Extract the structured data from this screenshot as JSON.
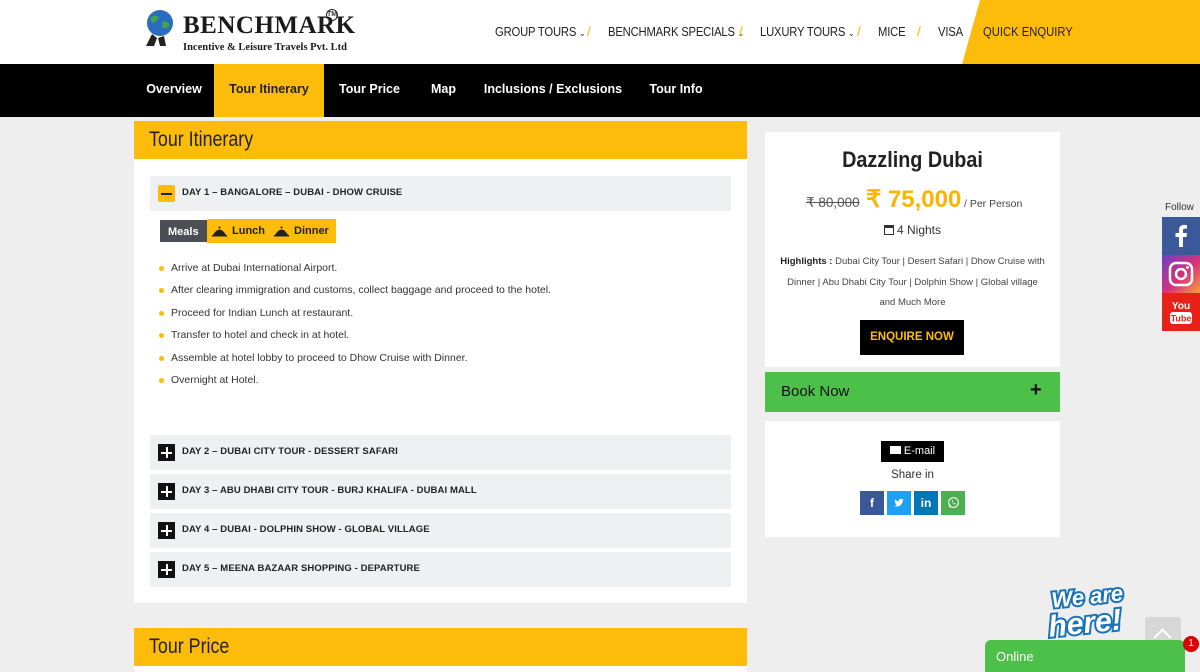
{
  "brand": {
    "name": "BENCHMARK",
    "trademark": "TM",
    "subtitle": "Incentive & Leisure Travels Pvt. Ltd"
  },
  "nav": {
    "items": [
      {
        "label": "GROUP TOURS",
        "dropdown": true
      },
      {
        "label": "BENCHMARK SPECIALS",
        "dropdown": true
      },
      {
        "label": "LUXURY TOURS",
        "dropdown": true
      },
      {
        "label": "MICE",
        "dropdown": false
      },
      {
        "label": "VISA",
        "dropdown": false
      }
    ],
    "separator": "/",
    "quick_enquiry": "QUICK ENQUIRY"
  },
  "tabs": [
    {
      "label": "Overview",
      "active": false
    },
    {
      "label": "Tour Itinerary",
      "active": true
    },
    {
      "label": "Tour Price",
      "active": false
    },
    {
      "label": "Map",
      "active": false
    },
    {
      "label": "Inclusions / Exclusions",
      "active": false
    },
    {
      "label": "Tour Info",
      "active": false
    }
  ],
  "itinerary": {
    "title": "Tour Itinerary",
    "days": [
      {
        "label": "DAY 1 – BANGALORE – DUBAI - DHOW CRUISE",
        "expanded": true,
        "meals_label": "Meals",
        "meals": [
          "Lunch",
          "Dinner"
        ],
        "items": [
          "Arrive at Dubai International Airport.",
          "After clearing immigration and customs, collect baggage and proceed to the hotel.",
          "Proceed for Indian Lunch at restaurant.",
          "Transfer to hotel and check in at hotel.",
          "Assemble at hotel lobby to proceed to Dhow Cruise with Dinner.",
          "Overnight at Hotel."
        ]
      },
      {
        "label": "DAY 2 – DUBAI CITY TOUR - DESSERT SAFARI",
        "expanded": false
      },
      {
        "label": "DAY 3 – ABU DHABI CITY TOUR - BURJ KHALIFA - DUBAI MALL",
        "expanded": false
      },
      {
        "label": "DAY 4 – DUBAI - DOLPHIN SHOW - GLOBAL VILLAGE",
        "expanded": false
      },
      {
        "label": "DAY 5 – MEENA BAZAAR SHOPPING - DEPARTURE",
        "expanded": false
      }
    ]
  },
  "tour_price": {
    "title": "Tour Price"
  },
  "package": {
    "title": "Dazzling Dubai",
    "old_price": "₹ 80,000",
    "new_price": "₹ 75,000",
    "per_person": "/ Per Person",
    "nights": "4 Nights",
    "highlights_label": "Highlights :",
    "highlights_text": "Dubai City Tour | Desert Safari | Dhow Cruise with Dinner | Abu Dhabi City Tour | Dolphin Show | Global village and Much More",
    "enquire_label": "ENQUIRE NOW"
  },
  "book_now": {
    "label": "Book Now",
    "plus": "+"
  },
  "share": {
    "email_label": "E-mail",
    "share_in": "Share in",
    "buttons": [
      {
        "name": "facebook",
        "glyph": "f",
        "color": "#3b5998"
      },
      {
        "name": "twitter",
        "glyph": "t",
        "color": "#1da1f2"
      },
      {
        "name": "linkedin",
        "glyph": "in",
        "color": "#0077b5"
      },
      {
        "name": "whatsapp",
        "glyph": "w",
        "color": "#4caf50"
      }
    ]
  },
  "follow": {
    "label": "Follow",
    "networks": [
      {
        "name": "facebook",
        "glyph": "f",
        "color": "#3b5998"
      },
      {
        "name": "instagram",
        "glyph": "ig",
        "color": "#c1358a"
      },
      {
        "name": "youtube",
        "glyph": "You Tube",
        "color": "#e62117"
      }
    ]
  },
  "chat": {
    "badge_text": "We are here!",
    "online_label": "Online",
    "unread_count": "1"
  },
  "colors": {
    "accent": "#fdbc0a",
    "green": "#4cc048",
    "nav_bg": "#000000"
  }
}
